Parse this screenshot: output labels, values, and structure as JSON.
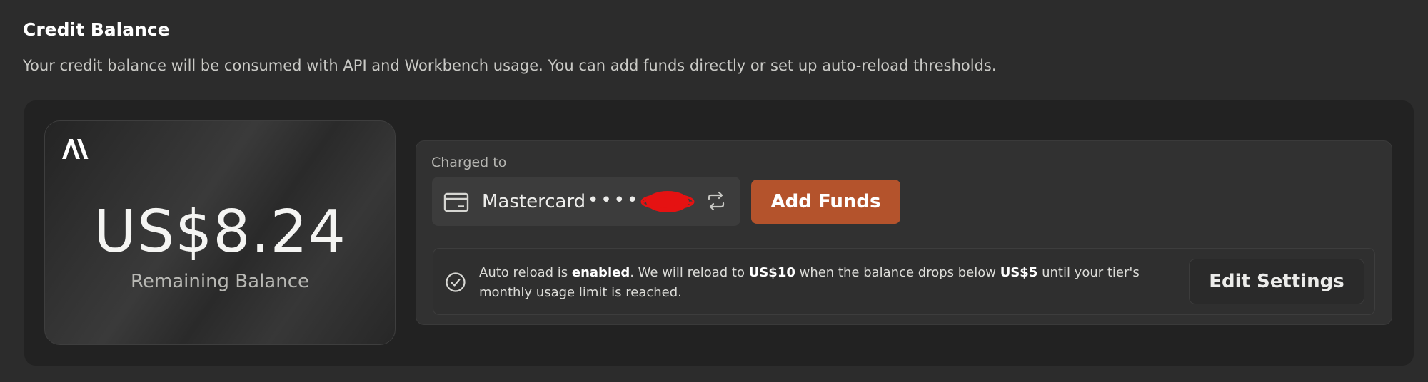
{
  "section": {
    "title": "Credit Balance",
    "description": "Your credit balance will be consumed with API and Workbench usage. You can add funds directly or set up auto-reload thresholds."
  },
  "balance_card": {
    "logo_icon": "anthropic-logo",
    "amount": "US$8.24",
    "label": "Remaining Balance"
  },
  "payment": {
    "charged_to_label": "Charged to",
    "card_icon": "credit-card-icon",
    "card_name": "Mastercard",
    "card_dots": "••••",
    "swap_icon": "swap-arrows-icon",
    "add_funds_label": "Add Funds",
    "add_funds_color": "#b4532c"
  },
  "auto_reload": {
    "status_icon": "check-circle-icon",
    "text_1": "Auto reload is ",
    "text_enabled": "enabled",
    "text_2": ". We will reload to ",
    "reload_amount": "US$10",
    "text_3": " when the balance drops below ",
    "threshold_amount": "US$5",
    "text_4": " until your tier's monthly usage limit is reached.",
    "edit_settings_label": "Edit Settings"
  }
}
